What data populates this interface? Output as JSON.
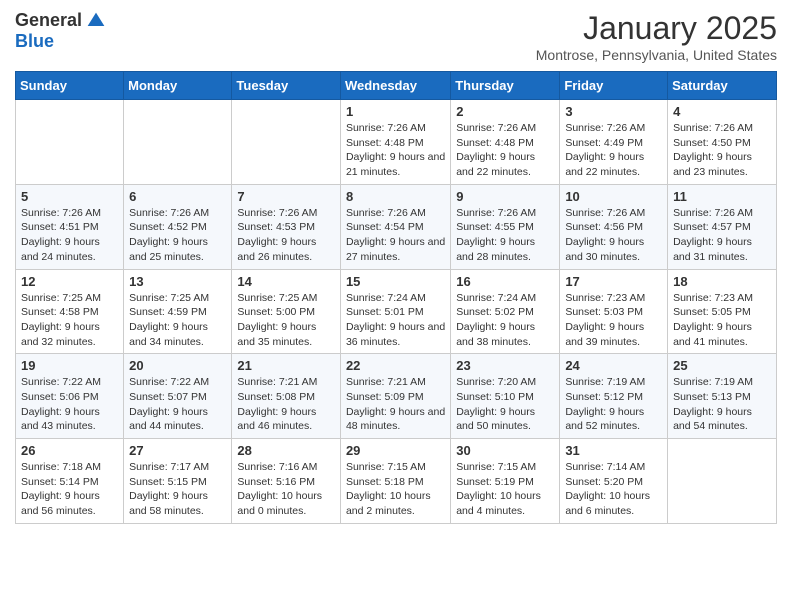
{
  "header": {
    "logo_general": "General",
    "logo_blue": "Blue",
    "month_title": "January 2025",
    "location": "Montrose, Pennsylvania, United States"
  },
  "days_of_week": [
    "Sunday",
    "Monday",
    "Tuesday",
    "Wednesday",
    "Thursday",
    "Friday",
    "Saturday"
  ],
  "weeks": [
    [
      {
        "day": "",
        "sunrise": "",
        "sunset": "",
        "daylight": ""
      },
      {
        "day": "",
        "sunrise": "",
        "sunset": "",
        "daylight": ""
      },
      {
        "day": "",
        "sunrise": "",
        "sunset": "",
        "daylight": ""
      },
      {
        "day": "1",
        "sunrise": "Sunrise: 7:26 AM",
        "sunset": "Sunset: 4:48 PM",
        "daylight": "Daylight: 9 hours and 21 minutes."
      },
      {
        "day": "2",
        "sunrise": "Sunrise: 7:26 AM",
        "sunset": "Sunset: 4:48 PM",
        "daylight": "Daylight: 9 hours and 22 minutes."
      },
      {
        "day": "3",
        "sunrise": "Sunrise: 7:26 AM",
        "sunset": "Sunset: 4:49 PM",
        "daylight": "Daylight: 9 hours and 22 minutes."
      },
      {
        "day": "4",
        "sunrise": "Sunrise: 7:26 AM",
        "sunset": "Sunset: 4:50 PM",
        "daylight": "Daylight: 9 hours and 23 minutes."
      }
    ],
    [
      {
        "day": "5",
        "sunrise": "Sunrise: 7:26 AM",
        "sunset": "Sunset: 4:51 PM",
        "daylight": "Daylight: 9 hours and 24 minutes."
      },
      {
        "day": "6",
        "sunrise": "Sunrise: 7:26 AM",
        "sunset": "Sunset: 4:52 PM",
        "daylight": "Daylight: 9 hours and 25 minutes."
      },
      {
        "day": "7",
        "sunrise": "Sunrise: 7:26 AM",
        "sunset": "Sunset: 4:53 PM",
        "daylight": "Daylight: 9 hours and 26 minutes."
      },
      {
        "day": "8",
        "sunrise": "Sunrise: 7:26 AM",
        "sunset": "Sunset: 4:54 PM",
        "daylight": "Daylight: 9 hours and 27 minutes."
      },
      {
        "day": "9",
        "sunrise": "Sunrise: 7:26 AM",
        "sunset": "Sunset: 4:55 PM",
        "daylight": "Daylight: 9 hours and 28 minutes."
      },
      {
        "day": "10",
        "sunrise": "Sunrise: 7:26 AM",
        "sunset": "Sunset: 4:56 PM",
        "daylight": "Daylight: 9 hours and 30 minutes."
      },
      {
        "day": "11",
        "sunrise": "Sunrise: 7:26 AM",
        "sunset": "Sunset: 4:57 PM",
        "daylight": "Daylight: 9 hours and 31 minutes."
      }
    ],
    [
      {
        "day": "12",
        "sunrise": "Sunrise: 7:25 AM",
        "sunset": "Sunset: 4:58 PM",
        "daylight": "Daylight: 9 hours and 32 minutes."
      },
      {
        "day": "13",
        "sunrise": "Sunrise: 7:25 AM",
        "sunset": "Sunset: 4:59 PM",
        "daylight": "Daylight: 9 hours and 34 minutes."
      },
      {
        "day": "14",
        "sunrise": "Sunrise: 7:25 AM",
        "sunset": "Sunset: 5:00 PM",
        "daylight": "Daylight: 9 hours and 35 minutes."
      },
      {
        "day": "15",
        "sunrise": "Sunrise: 7:24 AM",
        "sunset": "Sunset: 5:01 PM",
        "daylight": "Daylight: 9 hours and 36 minutes."
      },
      {
        "day": "16",
        "sunrise": "Sunrise: 7:24 AM",
        "sunset": "Sunset: 5:02 PM",
        "daylight": "Daylight: 9 hours and 38 minutes."
      },
      {
        "day": "17",
        "sunrise": "Sunrise: 7:23 AM",
        "sunset": "Sunset: 5:03 PM",
        "daylight": "Daylight: 9 hours and 39 minutes."
      },
      {
        "day": "18",
        "sunrise": "Sunrise: 7:23 AM",
        "sunset": "Sunset: 5:05 PM",
        "daylight": "Daylight: 9 hours and 41 minutes."
      }
    ],
    [
      {
        "day": "19",
        "sunrise": "Sunrise: 7:22 AM",
        "sunset": "Sunset: 5:06 PM",
        "daylight": "Daylight: 9 hours and 43 minutes."
      },
      {
        "day": "20",
        "sunrise": "Sunrise: 7:22 AM",
        "sunset": "Sunset: 5:07 PM",
        "daylight": "Daylight: 9 hours and 44 minutes."
      },
      {
        "day": "21",
        "sunrise": "Sunrise: 7:21 AM",
        "sunset": "Sunset: 5:08 PM",
        "daylight": "Daylight: 9 hours and 46 minutes."
      },
      {
        "day": "22",
        "sunrise": "Sunrise: 7:21 AM",
        "sunset": "Sunset: 5:09 PM",
        "daylight": "Daylight: 9 hours and 48 minutes."
      },
      {
        "day": "23",
        "sunrise": "Sunrise: 7:20 AM",
        "sunset": "Sunset: 5:10 PM",
        "daylight": "Daylight: 9 hours and 50 minutes."
      },
      {
        "day": "24",
        "sunrise": "Sunrise: 7:19 AM",
        "sunset": "Sunset: 5:12 PM",
        "daylight": "Daylight: 9 hours and 52 minutes."
      },
      {
        "day": "25",
        "sunrise": "Sunrise: 7:19 AM",
        "sunset": "Sunset: 5:13 PM",
        "daylight": "Daylight: 9 hours and 54 minutes."
      }
    ],
    [
      {
        "day": "26",
        "sunrise": "Sunrise: 7:18 AM",
        "sunset": "Sunset: 5:14 PM",
        "daylight": "Daylight: 9 hours and 56 minutes."
      },
      {
        "day": "27",
        "sunrise": "Sunrise: 7:17 AM",
        "sunset": "Sunset: 5:15 PM",
        "daylight": "Daylight: 9 hours and 58 minutes."
      },
      {
        "day": "28",
        "sunrise": "Sunrise: 7:16 AM",
        "sunset": "Sunset: 5:16 PM",
        "daylight": "Daylight: 10 hours and 0 minutes."
      },
      {
        "day": "29",
        "sunrise": "Sunrise: 7:15 AM",
        "sunset": "Sunset: 5:18 PM",
        "daylight": "Daylight: 10 hours and 2 minutes."
      },
      {
        "day": "30",
        "sunrise": "Sunrise: 7:15 AM",
        "sunset": "Sunset: 5:19 PM",
        "daylight": "Daylight: 10 hours and 4 minutes."
      },
      {
        "day": "31",
        "sunrise": "Sunrise: 7:14 AM",
        "sunset": "Sunset: 5:20 PM",
        "daylight": "Daylight: 10 hours and 6 minutes."
      },
      {
        "day": "",
        "sunrise": "",
        "sunset": "",
        "daylight": ""
      }
    ]
  ]
}
